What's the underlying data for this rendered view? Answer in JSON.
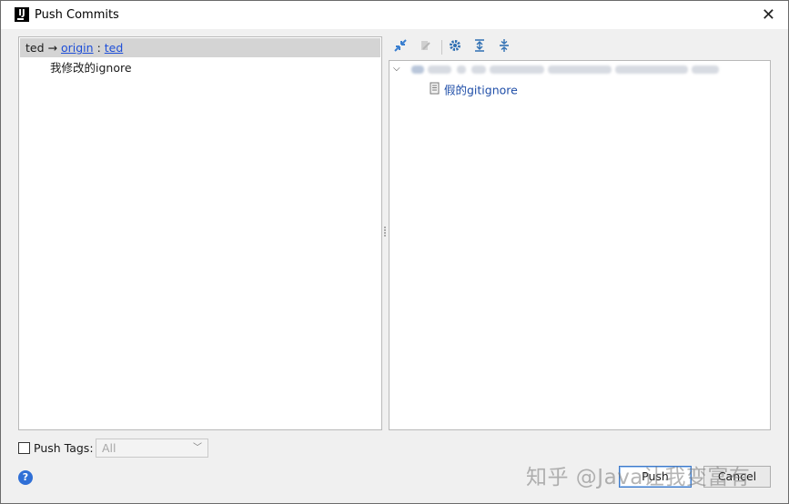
{
  "window": {
    "title": "Push Commits"
  },
  "left_panel": {
    "branch": {
      "local": "ted",
      "arrow": "→",
      "remote": "origin",
      "separator": ":",
      "target": "ted"
    },
    "commits": [
      {
        "message": "我修改的ignore"
      }
    ]
  },
  "toolbar": {
    "buttons": [
      {
        "icon": "collapse-arrows-icon"
      },
      {
        "icon": "edit-source-icon",
        "disabled": true
      },
      {
        "icon": "gear-icon"
      },
      {
        "icon": "expand-all-icon"
      },
      {
        "icon": "collapse-all-icon"
      }
    ]
  },
  "right_panel": {
    "files": [
      {
        "name": "假的gitignore"
      }
    ]
  },
  "footer": {
    "push_tags_label": "Push Tags:",
    "push_tags_checked": false,
    "tags_select": {
      "value": "All"
    },
    "help_symbol": "?",
    "push_label": "Push",
    "cancel_label": "Cancel"
  },
  "watermark": {
    "text": "知乎 @Java让我变富有"
  },
  "colors": {
    "link": "#1d4ed8",
    "selection": "#d4d4d4",
    "accent": "#3d79c9",
    "help": "#2f6fd6"
  }
}
